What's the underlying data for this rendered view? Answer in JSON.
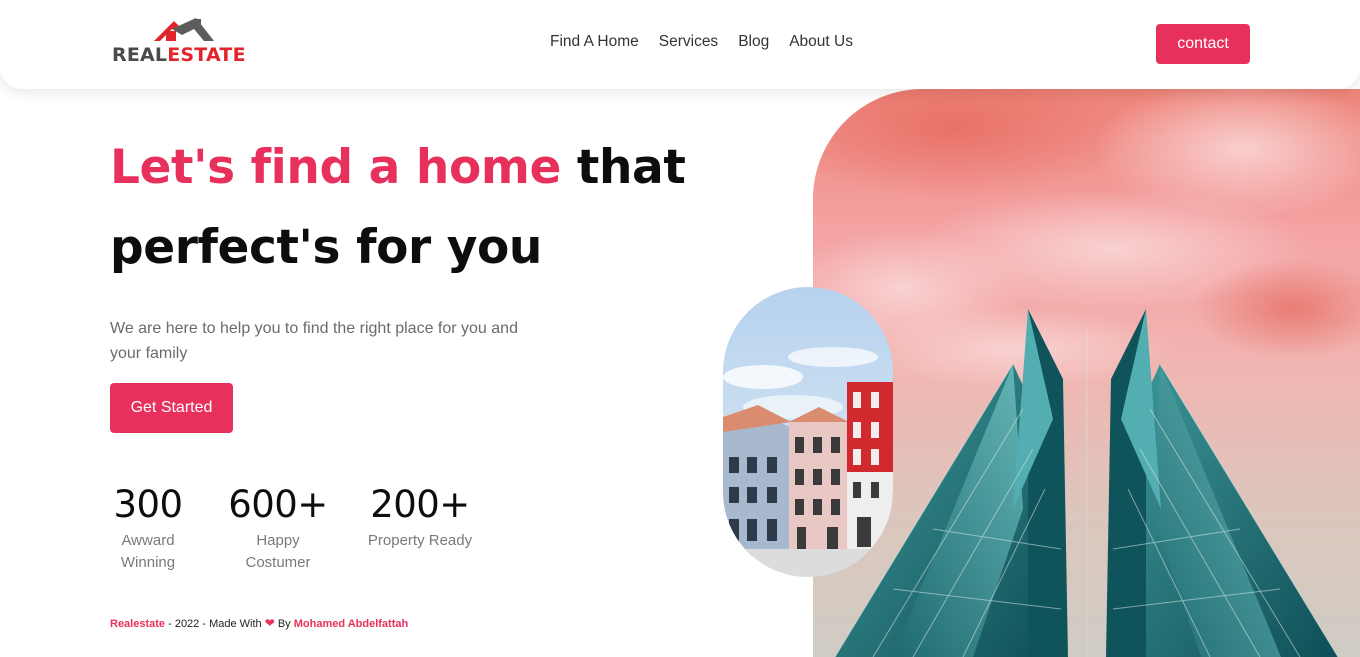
{
  "logo": {
    "part1": "REAL",
    "part2": "ESTATE"
  },
  "nav": {
    "items": [
      "Find A Home",
      "Services",
      "Blog",
      "About Us"
    ],
    "contact_label": "contact"
  },
  "hero": {
    "title_accent": "Let's find a home",
    "title_rest": " that perfect's for you",
    "subtitle": "We are here to help you to find the right place for you and your family",
    "cta_label": "Get Started"
  },
  "stats": [
    {
      "value": "300",
      "label": "Awward Winning"
    },
    {
      "value": "600+",
      "label": "Happy Costumer"
    },
    {
      "value": "200+",
      "label": "Property Ready"
    }
  ],
  "footer": {
    "brand": "Realestate",
    "middle": " - 2022 - Made With ",
    "heart": "❤",
    "by": " By ",
    "author": "Mohamed Abdelfattah"
  },
  "colors": {
    "accent": "#e8305c",
    "logo_red": "#e1252b",
    "logo_dark": "#4a4a4a"
  },
  "icons": {
    "logo": "house-roof-icon",
    "heart": "heart-icon"
  }
}
